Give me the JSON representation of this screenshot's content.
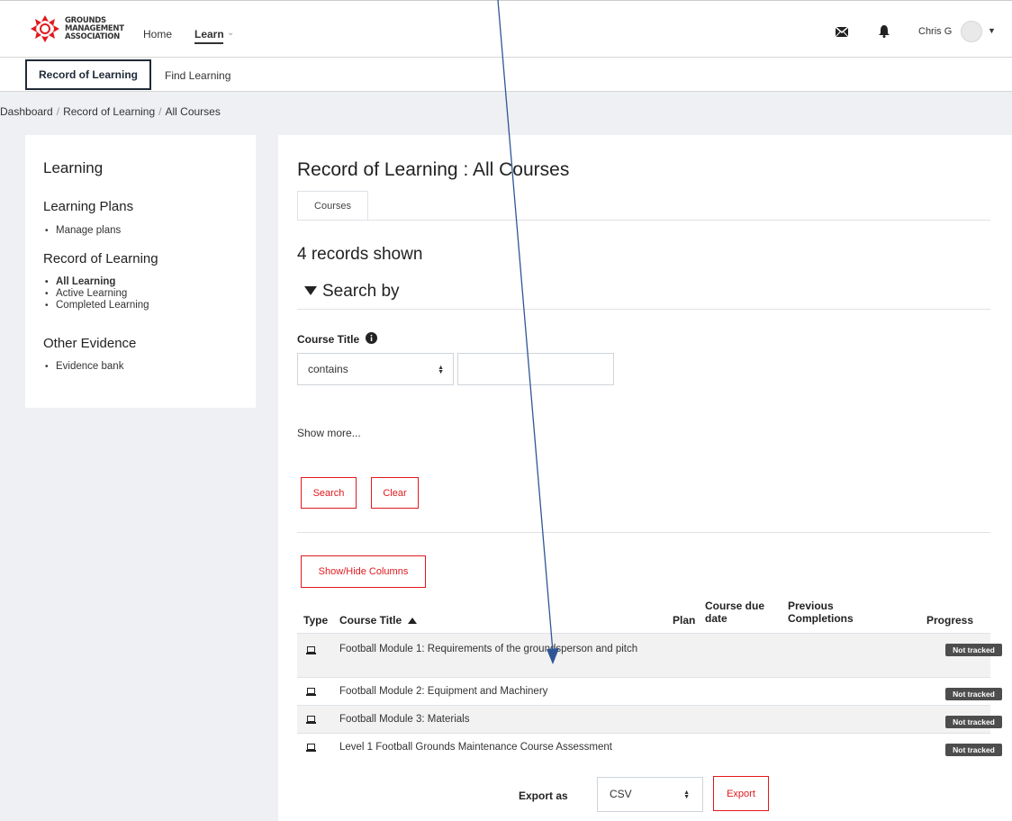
{
  "brand": {
    "logo_lines": [
      "GROUNDS",
      "MANAGEMENT",
      "ASSOCIATION"
    ],
    "accent_color": "#e0191e"
  },
  "topnav": {
    "home": "Home",
    "learn": "Learn",
    "user_name": "Chris G",
    "icons": [
      "mail-icon",
      "bell-icon",
      "avatar",
      "chevron-down-icon"
    ]
  },
  "subnav": {
    "items": [
      "Record of Learning",
      "Find Learning"
    ]
  },
  "breadcrumb": [
    "Dashboard",
    "Record of Learning",
    "All Courses"
  ],
  "sidebar": {
    "title": "Learning",
    "sections": [
      {
        "heading": "Learning Plans",
        "items": [
          "Manage plans"
        ]
      },
      {
        "heading": "Record of Learning",
        "items": [
          "All Learning",
          "Active Learning",
          "Completed Learning"
        ]
      },
      {
        "heading": "Other Evidence",
        "items": [
          "Evidence bank"
        ]
      }
    ]
  },
  "main": {
    "title": "Record of Learning : All Courses",
    "tab": "Courses",
    "records_shown": "4 records shown",
    "search_by": "Search by",
    "course_title_label": "Course Title",
    "filter_operator": "contains",
    "filter_value": "",
    "show_more": "Show more...",
    "search_button": "Search",
    "clear_button": "Clear",
    "show_hide_button": "Show/Hide Columns"
  },
  "table": {
    "headers": {
      "type": "Type",
      "course_title": "Course Title",
      "plan": "Plan",
      "due_line1": "Course due",
      "due_line2": "date",
      "prev_line1": "Previous",
      "prev_line2": "Completions",
      "progress": "Progress"
    },
    "rows": [
      {
        "title": "Football Module 1: Requirements of the groundsperson and pitch",
        "progress": "Not tracked"
      },
      {
        "title": "Football Module 2: Equipment and Machinery",
        "progress": "Not tracked"
      },
      {
        "title": "Football Module 3: Materials",
        "progress": "Not tracked"
      },
      {
        "title": "Level 1 Football Grounds Maintenance Course Assessment",
        "progress": "Not tracked"
      }
    ]
  },
  "export": {
    "label": "Export as",
    "format": "CSV",
    "button": "Export"
  }
}
